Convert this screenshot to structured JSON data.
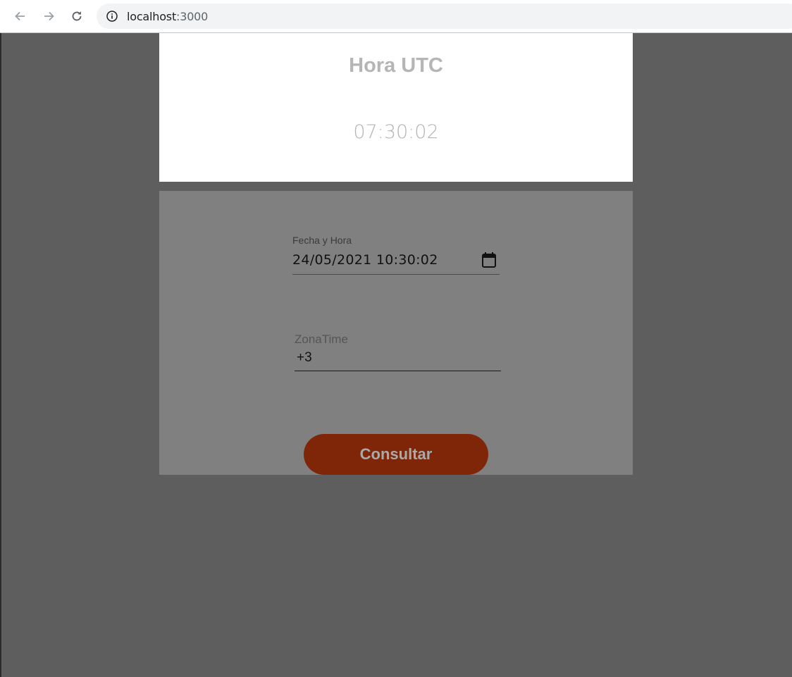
{
  "browser": {
    "url_host": "localhost",
    "url_port": ":3000",
    "icons": [
      "back-arrow-icon",
      "forward-arrow-icon",
      "reload-icon",
      "info-icon"
    ]
  },
  "utc_card": {
    "title": "Hora UTC",
    "time": "07:30:02"
  },
  "form": {
    "datetime_label": "Fecha y Hora",
    "datetime_value": "24/05/2021 10:30:02",
    "zone_label": "ZonaTime",
    "zone_value": "+3",
    "submit_label": "Consultar"
  },
  "colors": {
    "page_bg": "#5e5e5e",
    "panel_bg": "#808080",
    "button_bg": "#7f2608",
    "button_text": "#a9a9a9",
    "card_text": "#b5b5b5"
  }
}
